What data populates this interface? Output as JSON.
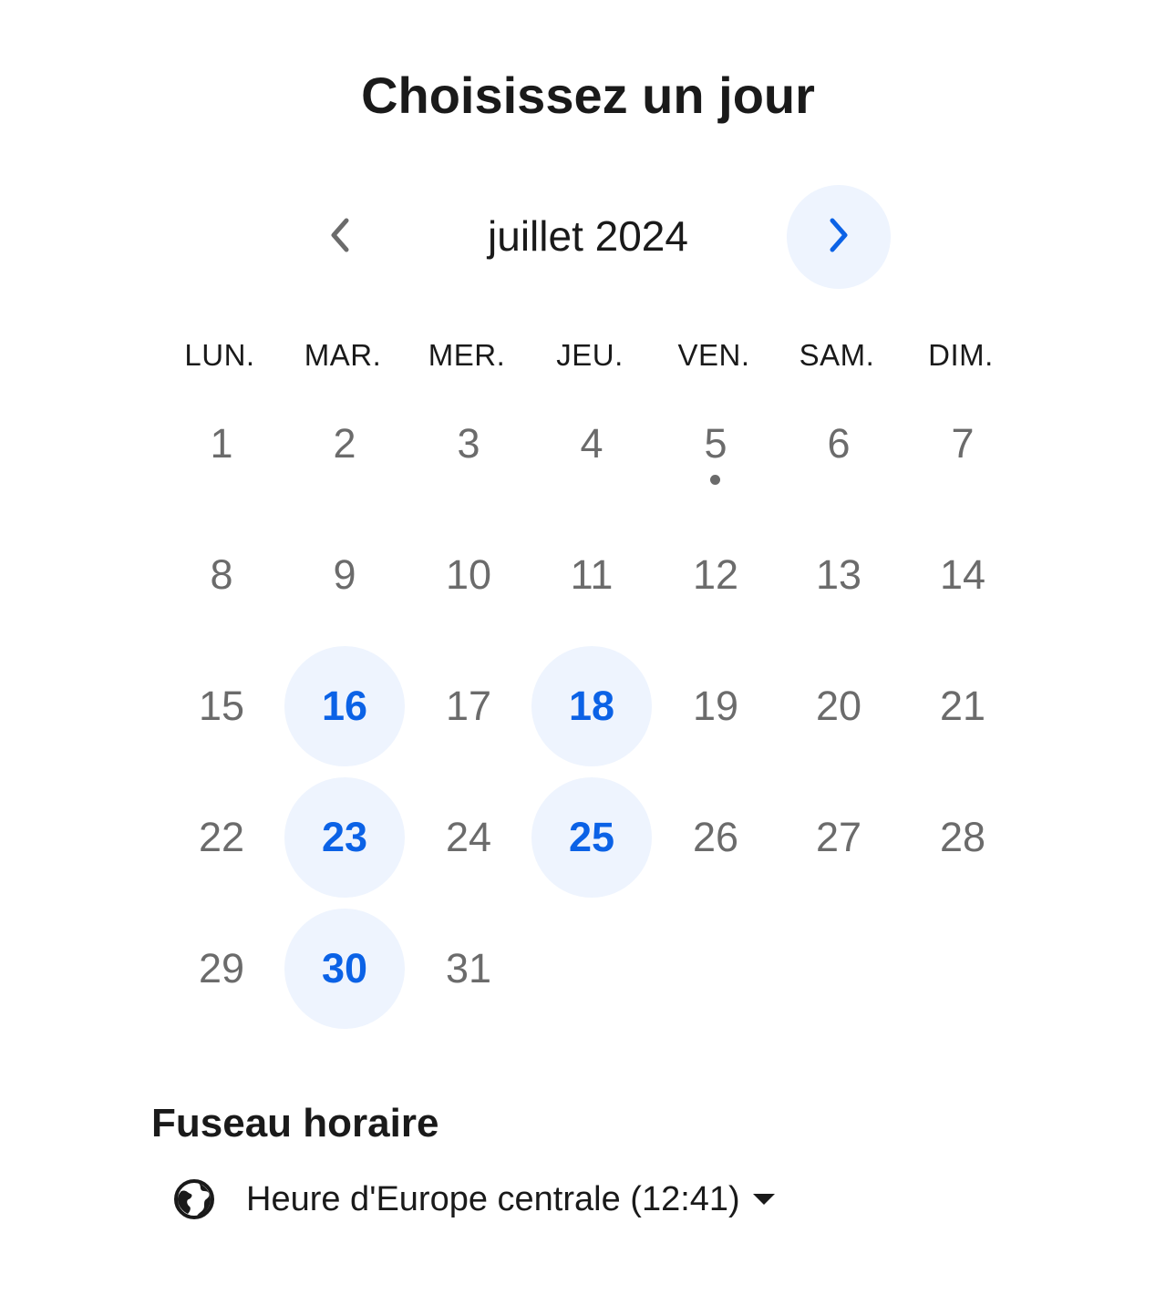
{
  "header": {
    "title": "Choisissez un jour"
  },
  "calendar": {
    "month_label": "juillet 2024",
    "prev_icon": "chevron-left-icon",
    "next_icon": "chevron-right-icon",
    "weekdays": [
      "LUN.",
      "MAR.",
      "MER.",
      "JEU.",
      "VEN.",
      "SAM.",
      "DIM."
    ],
    "days": [
      {
        "label": "1",
        "available": false
      },
      {
        "label": "2",
        "available": false
      },
      {
        "label": "3",
        "available": false
      },
      {
        "label": "4",
        "available": false
      },
      {
        "label": "5",
        "available": false,
        "today": true
      },
      {
        "label": "6",
        "available": false
      },
      {
        "label": "7",
        "available": false
      },
      {
        "label": "8",
        "available": false
      },
      {
        "label": "9",
        "available": false
      },
      {
        "label": "10",
        "available": false
      },
      {
        "label": "11",
        "available": false
      },
      {
        "label": "12",
        "available": false
      },
      {
        "label": "13",
        "available": false
      },
      {
        "label": "14",
        "available": false
      },
      {
        "label": "15",
        "available": false
      },
      {
        "label": "16",
        "available": true
      },
      {
        "label": "17",
        "available": false
      },
      {
        "label": "18",
        "available": true
      },
      {
        "label": "19",
        "available": false
      },
      {
        "label": "20",
        "available": false
      },
      {
        "label": "21",
        "available": false
      },
      {
        "label": "22",
        "available": false
      },
      {
        "label": "23",
        "available": true
      },
      {
        "label": "24",
        "available": false
      },
      {
        "label": "25",
        "available": true
      },
      {
        "label": "26",
        "available": false
      },
      {
        "label": "27",
        "available": false
      },
      {
        "label": "28",
        "available": false
      },
      {
        "label": "29",
        "available": false
      },
      {
        "label": "30",
        "available": true
      },
      {
        "label": "31",
        "available": false
      }
    ],
    "colors": {
      "available_bg": "#eef4fe",
      "available_text": "#0b62e6",
      "unavailable_text": "#6b6b6b"
    }
  },
  "timezone": {
    "title": "Fuseau horaire",
    "value": "Heure d'Europe centrale (12:41)",
    "icon": "globe-icon",
    "dropdown_icon": "caret-down-icon"
  }
}
